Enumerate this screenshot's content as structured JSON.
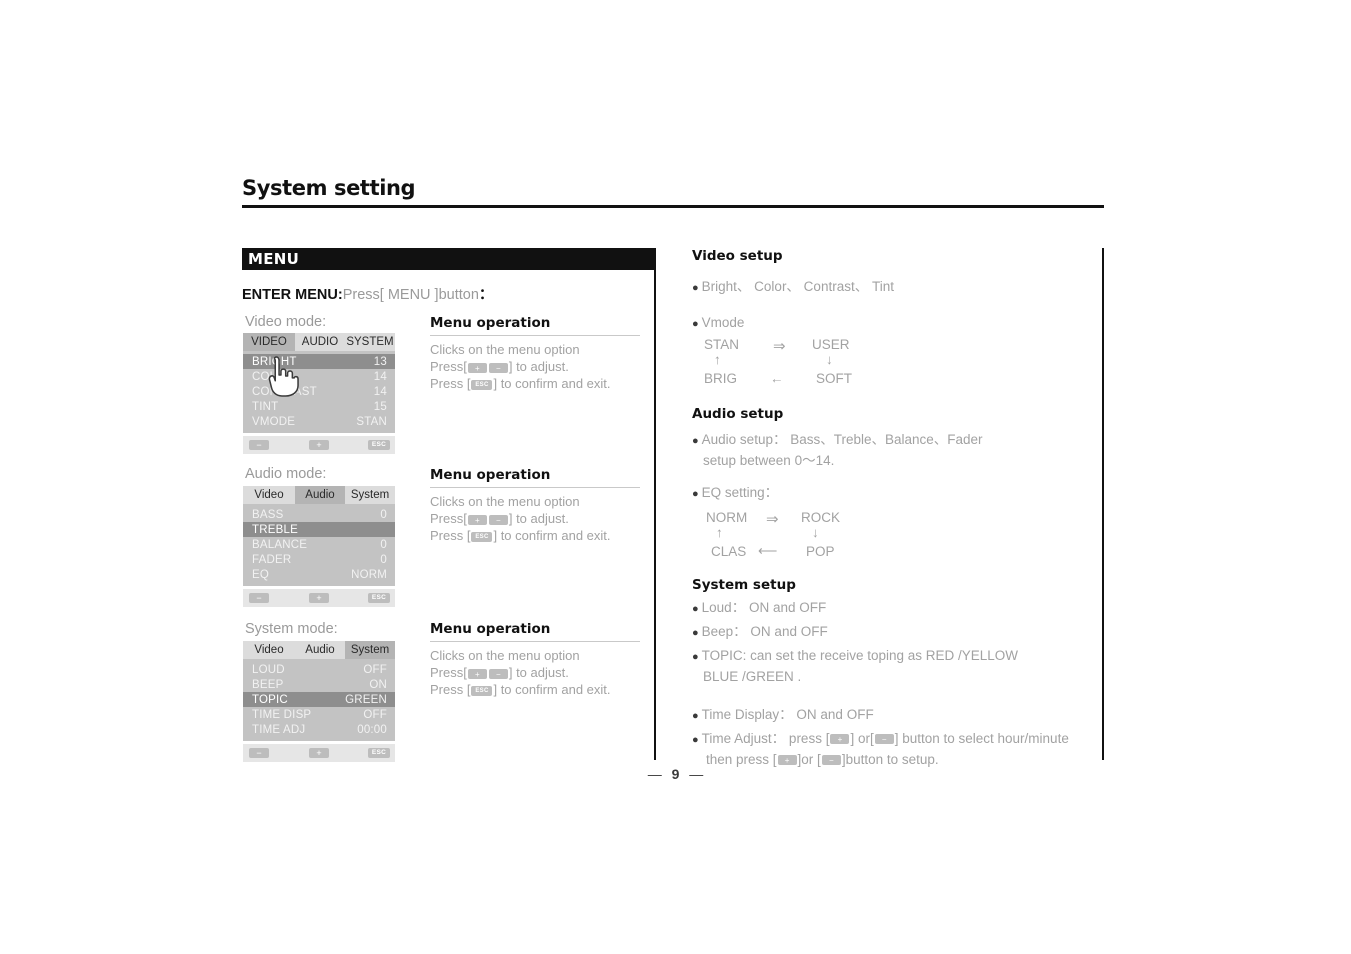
{
  "page": {
    "title": "System setting",
    "page_number": "9",
    "page_dash_left": "—",
    "page_dash_right": "—"
  },
  "menu_bar": {
    "label": "MENU"
  },
  "enter_menu": {
    "label": "ENTER MENU:",
    "instruction": "Press[ MENU ]button",
    "colon": "："
  },
  "captions": {
    "video_mode": "Video mode:",
    "audio_mode": "Audio mode:",
    "system_mode": "System mode:"
  },
  "osd_panels": [
    {
      "id": "video",
      "tabs": [
        {
          "label": "VIDEO",
          "active": true
        },
        {
          "label": "AUDIO",
          "active": false
        },
        {
          "label": "SYSTEM",
          "active": false
        }
      ],
      "rows": [
        {
          "label": "BRIGHT",
          "value": "13",
          "selected": true
        },
        {
          "label": "COLOR",
          "value": "14",
          "selected": false
        },
        {
          "label": "CONTRAST",
          "value": "14",
          "selected": false
        },
        {
          "label": "TINT",
          "value": "15",
          "selected": false
        },
        {
          "label": "VMODE",
          "value": "STAN",
          "selected": false
        }
      ],
      "buttons": {
        "minus": "−",
        "plus": "+",
        "esc": "ESC"
      },
      "has_cursor": true
    },
    {
      "id": "audio",
      "tabs": [
        {
          "label": "Video",
          "active": false
        },
        {
          "label": "Audio",
          "active": true
        },
        {
          "label": "System",
          "active": false
        }
      ],
      "rows": [
        {
          "label": "BASS",
          "value": "0",
          "selected": false
        },
        {
          "label": "TREBLE",
          "value": "",
          "selected": true
        },
        {
          "label": "BALANCE",
          "value": "0",
          "selected": false
        },
        {
          "label": "FADER",
          "value": "0",
          "selected": false
        },
        {
          "label": "EQ",
          "value": "NORM",
          "selected": false
        }
      ],
      "buttons": {
        "minus": "−",
        "plus": "+",
        "esc": "ESC"
      },
      "has_cursor": false
    },
    {
      "id": "system",
      "tabs": [
        {
          "label": "Video",
          "active": false
        },
        {
          "label": "Audio",
          "active": false
        },
        {
          "label": "System",
          "active": true
        }
      ],
      "rows": [
        {
          "label": "LOUD",
          "value": "OFF",
          "selected": false
        },
        {
          "label": "BEEP",
          "value": "ON",
          "selected": false
        },
        {
          "label": "TOPIC",
          "value": "GREEN",
          "selected": true
        },
        {
          "label": "TIME DISP",
          "value": "OFF",
          "selected": false
        },
        {
          "label": "TIME ADJ",
          "value": "00:00",
          "selected": false
        }
      ],
      "buttons": {
        "minus": "−",
        "plus": "+",
        "esc": "ESC"
      },
      "has_cursor": false
    }
  ],
  "menu_operations": [
    {
      "heading": "Menu operation",
      "line1": "Clicks on the menu option",
      "line2_pre": "Press[",
      "key_plus": "+",
      "key_minus": "−",
      "line2_post": "] to adjust.",
      "line3_pre": "Press [",
      "key_esc": "ESC",
      "line3_post": "] to confirm and exit."
    },
    {
      "heading": "Menu operation",
      "line1": "Clicks on the menu option",
      "line2_pre": "Press[",
      "key_plus": "+",
      "key_minus": "−",
      "line2_post": "] to adjust.",
      "line3_pre": "Press [",
      "key_esc": "ESC",
      "line3_post": "] to confirm and exit."
    },
    {
      "heading": "Menu operation",
      "line1": "Clicks on the menu option",
      "line2_pre": "Press[",
      "key_plus": "+",
      "key_minus": "−",
      "line2_post": "] to adjust.",
      "line3_pre": "Press [",
      "key_esc": "ESC",
      "line3_post": "] to confirm and exit."
    }
  ],
  "video_setup": {
    "heading": "Video setup",
    "bullet1": "Bright、 Color、 Contrast、 Tint",
    "bullet2": "Vmode",
    "cycle": {
      "top_left": "STAN",
      "top_right": "USER",
      "bottom_left": "BRIG",
      "bottom_right": "SOFT",
      "arrow_top": "⇒",
      "arrow_right": "↓",
      "arrow_bottom": "←",
      "arrow_left": "↑"
    }
  },
  "audio_setup": {
    "heading": "Audio setup",
    "bullet1_line1": "Audio setup： Bass、Treble、Balance、Fader",
    "bullet1_line2": "setup between 0～14.",
    "bullet2": "EQ setting：",
    "cycle": {
      "top_left": "NORM",
      "top_right": "ROCK",
      "bottom_left": "CLAS",
      "bottom_right": "POP",
      "arrow_top": "⇒",
      "arrow_right": "↓",
      "arrow_bottom": "⟵",
      "arrow_left": "↑"
    }
  },
  "system_setup": {
    "heading": "System setup",
    "bullet_loud": "Loud： ON and OFF",
    "bullet_beep": "Beep： ON and OFF",
    "bullet_topic_line1": "TOPIC: can set the receive toping as RED /YELLOW",
    "bullet_topic_line2": "BLUE /GREEN .",
    "bullet_timedisp": "Time Display： ON and OFF",
    "bullet_timeadj_pre": "Time Adjust：  press [",
    "bullet_timeadj_mid": "] or[",
    "bullet_timeadj_post": "] button to select hour/minute",
    "bullet_timeadj_l2_pre": "then press [",
    "bullet_timeadj_l2_mid": "]or [",
    "bullet_timeadj_l2_post": "]button to setup.",
    "key_plus": "+",
    "key_minus": "−"
  },
  "colors": {
    "ink": "#111111",
    "body_grey": "#a2a2a2",
    "osd_bg": "#c3c3c3",
    "osd_tab_bg": "#dcdcdc",
    "osd_tab_active": "#b4b4b4",
    "osd_row_selected": "#8e8e8e",
    "osd_btnbar": "#e6e6e6",
    "osd_button": "#bdbdbd"
  }
}
